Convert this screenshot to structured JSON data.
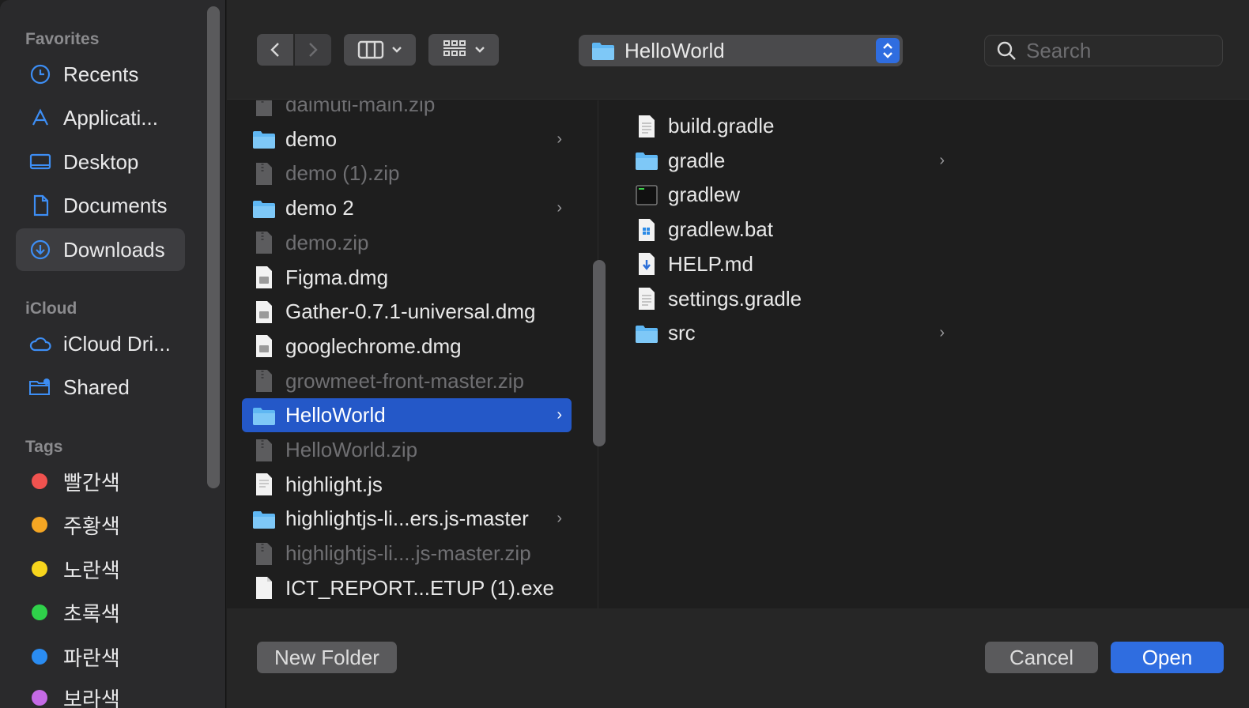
{
  "sidebar": {
    "favorites_label": "Favorites",
    "favorites": [
      {
        "label": "Recents",
        "icon": "clock-icon"
      },
      {
        "label": "Applicati...",
        "icon": "applications-icon"
      },
      {
        "label": "Desktop",
        "icon": "desktop-icon"
      },
      {
        "label": "Documents",
        "icon": "document-icon"
      },
      {
        "label": "Downloads",
        "icon": "download-icon",
        "active": true
      }
    ],
    "icloud_label": "iCloud",
    "icloud": [
      {
        "label": "iCloud Dri...",
        "icon": "cloud-icon"
      },
      {
        "label": "Shared",
        "icon": "shared-folder-icon"
      }
    ],
    "tags_label": "Tags",
    "tags": [
      {
        "label": "빨간색",
        "color": "#f0524f"
      },
      {
        "label": "주황색",
        "color": "#f5a623"
      },
      {
        "label": "노란색",
        "color": "#f7d51d"
      },
      {
        "label": "초록색",
        "color": "#2fd14a"
      },
      {
        "label": "파란색",
        "color": "#2a8cf2"
      },
      {
        "label": "보라색",
        "color": "#c56ae6"
      }
    ]
  },
  "toolbar": {
    "path_label": "HelloWorld",
    "search_placeholder": "Search"
  },
  "column1": [
    {
      "label": "daimuti-main.zip",
      "type": "zip",
      "dim": true
    },
    {
      "label": "demo",
      "type": "folder",
      "chevron": true
    },
    {
      "label": "demo (1).zip",
      "type": "zip",
      "dim": true
    },
    {
      "label": "demo 2",
      "type": "folder",
      "chevron": true
    },
    {
      "label": "demo.zip",
      "type": "zip",
      "dim": true
    },
    {
      "label": "Figma.dmg",
      "type": "dmg"
    },
    {
      "label": "Gather-0.7.1-universal.dmg",
      "type": "dmg"
    },
    {
      "label": "googlechrome.dmg",
      "type": "dmg"
    },
    {
      "label": "growmeet-front-master.zip",
      "type": "zip",
      "dim": true
    },
    {
      "label": "HelloWorld",
      "type": "folder",
      "chevron": true,
      "selected": true
    },
    {
      "label": "HelloWorld.zip",
      "type": "zip",
      "dim": true
    },
    {
      "label": "highlight.js",
      "type": "js"
    },
    {
      "label": "highlightjs-li...ers.js-master",
      "type": "folder",
      "chevron": true
    },
    {
      "label": "highlightjs-li....js-master.zip",
      "type": "zip",
      "dim": true
    },
    {
      "label": "ICT_REPORT...ETUP (1).exe",
      "type": "file"
    }
  ],
  "column2": [
    {
      "label": "build.gradle",
      "type": "text"
    },
    {
      "label": "gradle",
      "type": "folder",
      "chevron": true
    },
    {
      "label": "gradlew",
      "type": "exec"
    },
    {
      "label": "gradlew.bat",
      "type": "bat"
    },
    {
      "label": "HELP.md",
      "type": "md"
    },
    {
      "label": "settings.gradle",
      "type": "text"
    },
    {
      "label": "src",
      "type": "folder",
      "chevron": true
    }
  ],
  "bottom": {
    "new_folder_label": "New Folder",
    "cancel_label": "Cancel",
    "open_label": "Open"
  }
}
